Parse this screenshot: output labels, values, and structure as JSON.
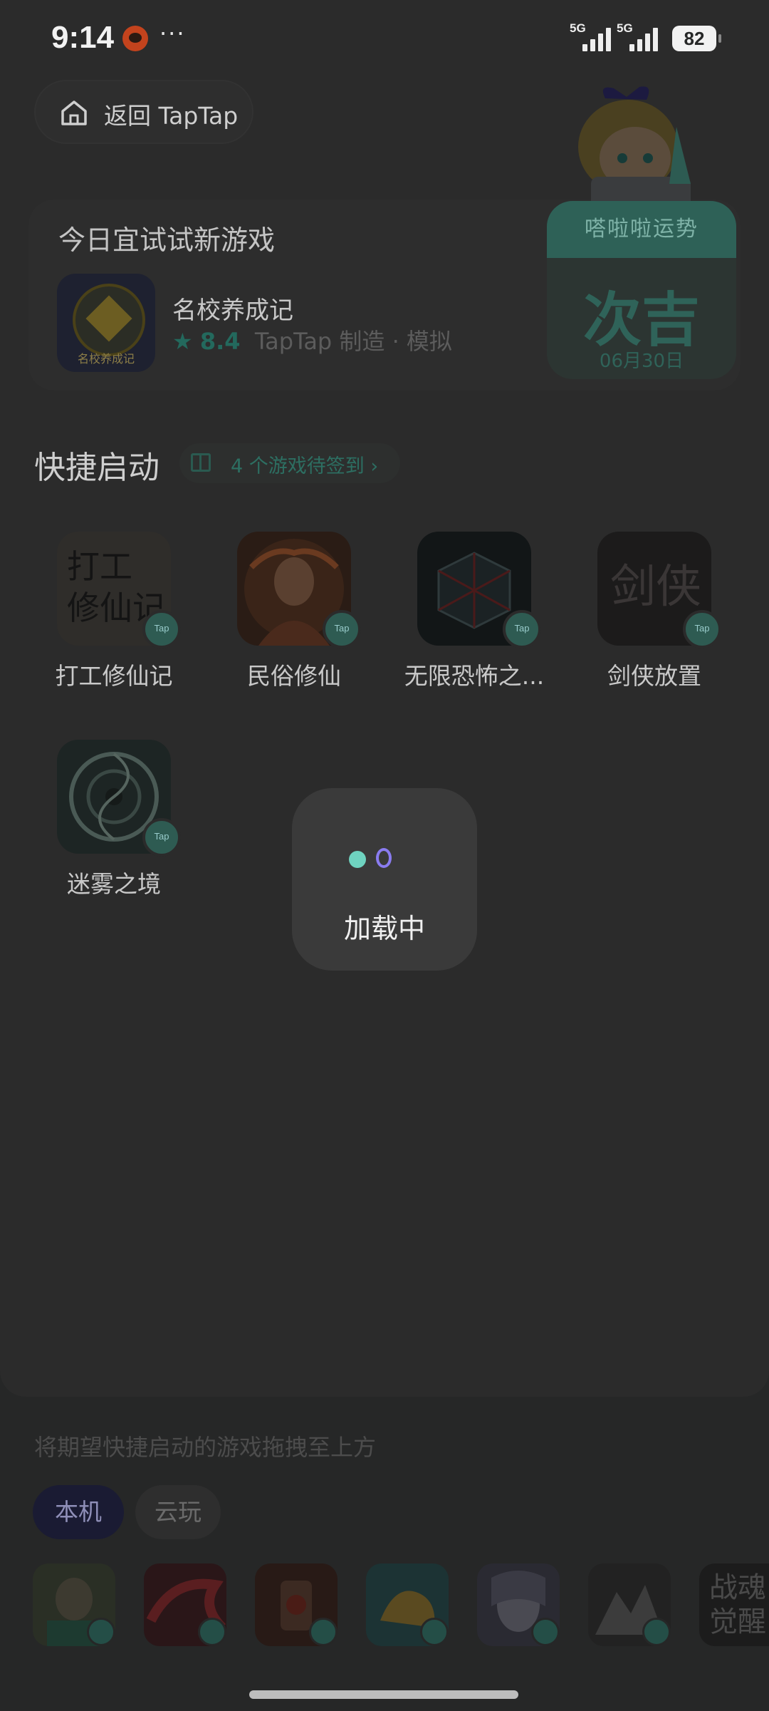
{
  "status_bar": {
    "time": "9:14",
    "more": "···",
    "signal1_label": "5G",
    "signal2_label": "5G",
    "battery": "82"
  },
  "header": {
    "back_label": "返回 TapTap"
  },
  "fortune": {
    "title": "嗒啦啦运势",
    "result": "次吉",
    "date": "06月30日"
  },
  "daily_pick": {
    "title": "今日宜试试新游戏",
    "game_name": "名校养成记",
    "icon_text": "名校养成记",
    "star": "★",
    "rating": "8.4",
    "meta": "TapTap 制造 · 模拟"
  },
  "quick_launch": {
    "title": "快捷启动",
    "checkin": "4 个游戏待签到 ›",
    "games": [
      {
        "name": "打工修仙记",
        "icon_text": "打工\n修仙记"
      },
      {
        "name": "民俗修仙"
      },
      {
        "name": "无限恐怖之..."
      },
      {
        "name": "剑侠放置",
        "icon_text": "剑侠"
      },
      {
        "name": "迷雾之境"
      }
    ]
  },
  "loading": {
    "label": "加载中"
  },
  "drawer": {
    "hint": "将期望快捷启动的游戏拖拽至上方",
    "tab_local": "本机",
    "tab_cloud": "云玩",
    "last_icon_text": "战魂\n觉醒"
  },
  "colors": {
    "accent_teal": "#2e6157",
    "loading_dot_teal": "#6fd3c0",
    "loading_dot_purple": "#8a7cf0",
    "local_tab": "#1a1b33"
  }
}
